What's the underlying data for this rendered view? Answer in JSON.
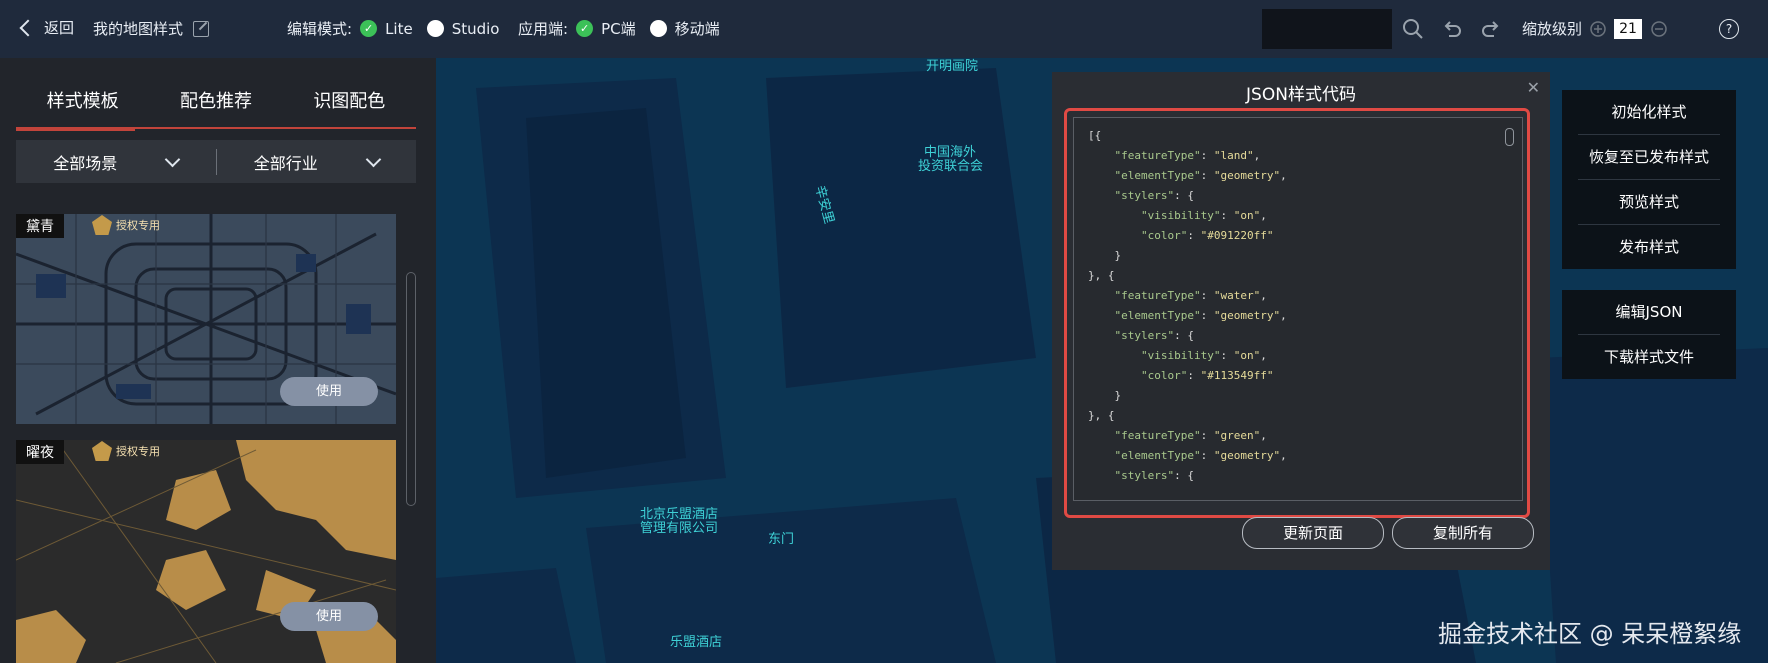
{
  "header": {
    "back_label": "返回",
    "map_name": "我的地图样式",
    "edit_mode_label": "编辑模式:",
    "edit_modes": [
      {
        "label": "Lite",
        "selected": true
      },
      {
        "label": "Studio",
        "selected": false
      }
    ],
    "platform_label": "应用端:",
    "platforms": [
      {
        "label": "PC端",
        "selected": true
      },
      {
        "label": "移动端",
        "selected": false
      }
    ],
    "zoom_label": "缩放级别",
    "zoom_value": "21"
  },
  "left_panel": {
    "tabs": [
      "样式模板",
      "配色推荐",
      "识图配色"
    ],
    "active_tab": 0,
    "filters": [
      "全部场景",
      "全部行业"
    ],
    "templates": [
      {
        "name": "黛青",
        "badge": "授权专用",
        "use_label": "使用"
      },
      {
        "name": "曜夜",
        "badge": "授权专用",
        "use_label": "使用"
      }
    ]
  },
  "map": {
    "labels": [
      "开明画院",
      "中国海外",
      "投资联合会",
      "辛安里",
      "北京乐盟酒店",
      "管理有限公司",
      "东门",
      "乐盟酒店"
    ]
  },
  "dialog": {
    "title": "JSON样式代码",
    "code_lines": [
      "[{",
      "    \"featureType\": \"land\",",
      "    \"elementType\": \"geometry\",",
      "    \"stylers\": {",
      "        \"visibility\": \"on\",",
      "        \"color\": \"#091220ff\"",
      "    }",
      "}, {",
      "    \"featureType\": \"water\",",
      "    \"elementType\": \"geometry\",",
      "    \"stylers\": {",
      "        \"visibility\": \"on\",",
      "        \"color\": \"#113549ff\"",
      "    }",
      "}, {",
      "    \"featureType\": \"green\",",
      "    \"elementType\": \"geometry\",",
      "    \"stylers\": {"
    ],
    "update_button": "更新页面",
    "copy_button": "复制所有"
  },
  "right_panel": {
    "group1": [
      "初始化样式",
      "恢复至已发布样式",
      "预览样式",
      "发布样式"
    ],
    "group2": [
      "编辑JSON",
      "下载样式文件"
    ]
  },
  "watermark": "掘金技术社区 @ 呆呆橙絮缘",
  "colors": {
    "accent": "#c2443b",
    "radio_on": "#3cc158",
    "highlight": "#e04a44"
  }
}
